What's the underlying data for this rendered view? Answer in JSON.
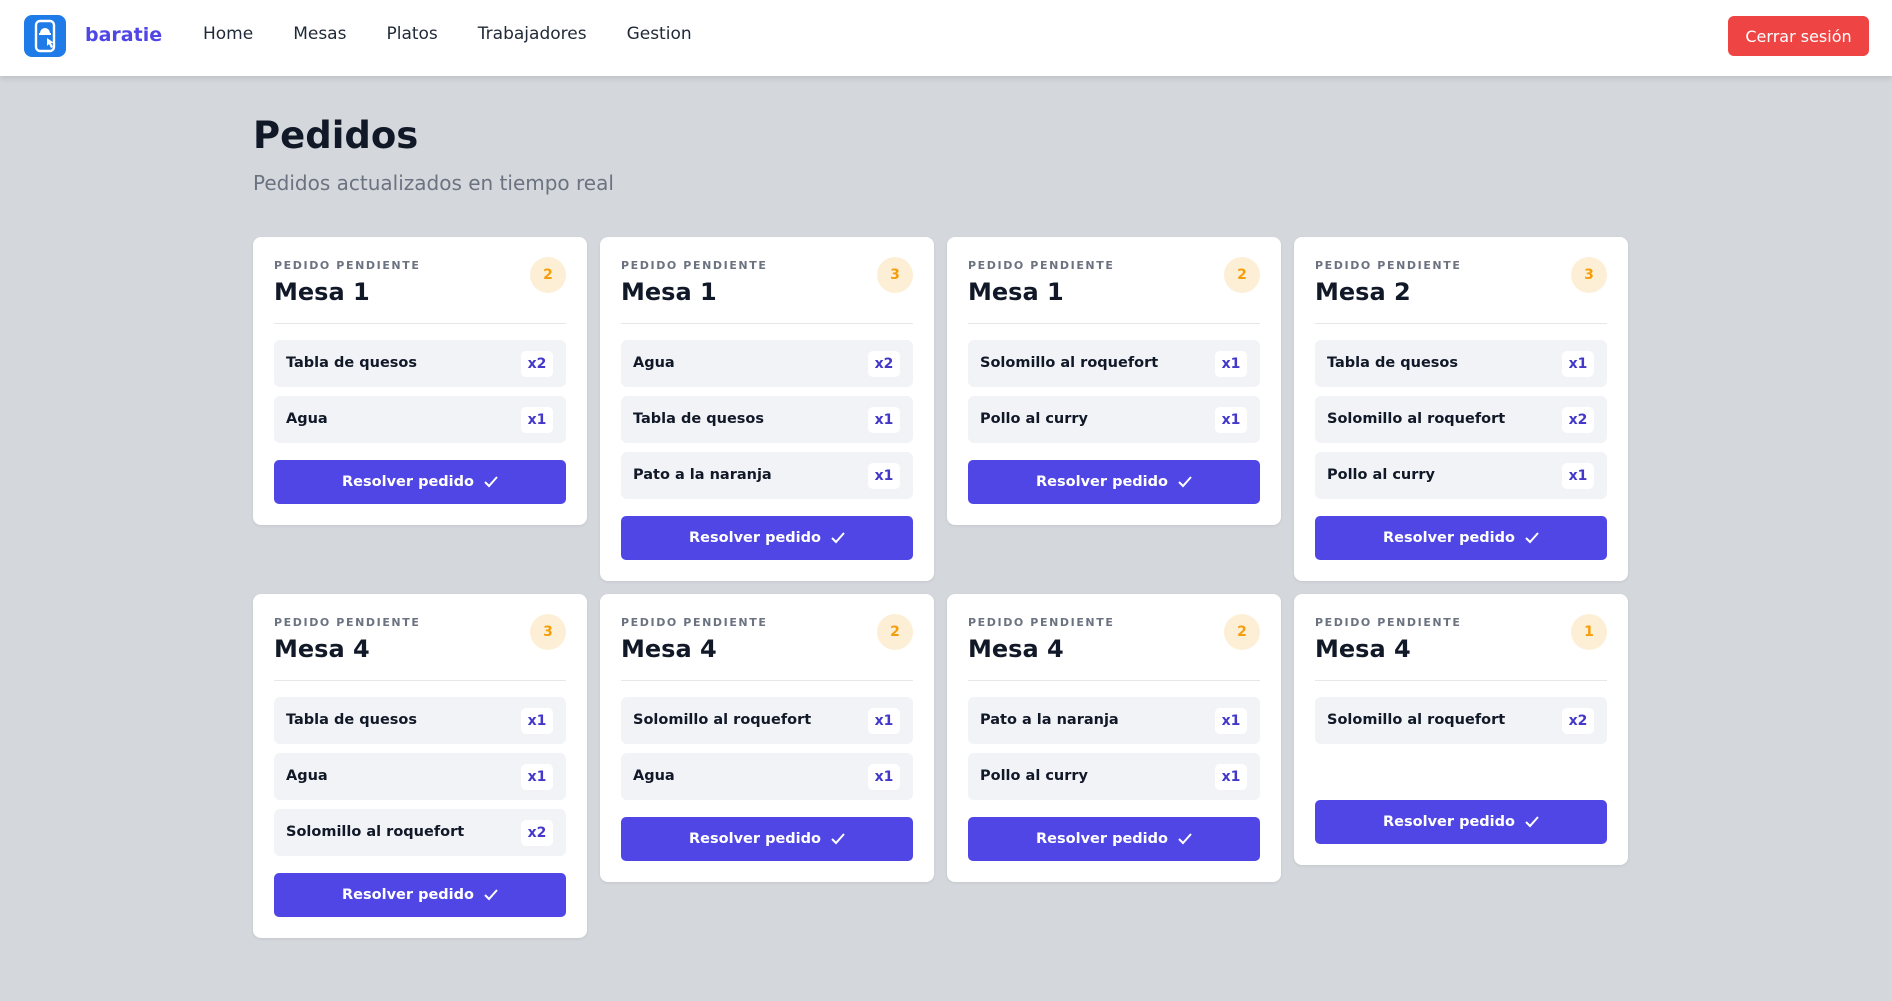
{
  "nav": {
    "brand": "baratie",
    "links": [
      "Home",
      "Mesas",
      "Platos",
      "Trabajadores",
      "Gestion"
    ],
    "logout_label": "Cerrar sesión"
  },
  "page": {
    "title": "Pedidos",
    "subtitle": "Pedidos actualizados en tiempo real"
  },
  "colors": {
    "accent": "#4f46e5",
    "danger": "#ef4444",
    "badge_bg": "#fdefd6",
    "badge_text": "#f59e0b"
  },
  "orders": [
    {
      "status": "PEDIDO PENDIENTE",
      "mesa": "Mesa 1",
      "count": "2",
      "button": "Resolver pedido",
      "items": [
        {
          "name": "Tabla de quesos",
          "qty": "x2"
        },
        {
          "name": "Agua",
          "qty": "x1"
        }
      ]
    },
    {
      "status": "PEDIDO PENDIENTE",
      "mesa": "Mesa 1",
      "count": "3",
      "button": "Resolver pedido",
      "items": [
        {
          "name": "Agua",
          "qty": "x2"
        },
        {
          "name": "Tabla de quesos",
          "qty": "x1"
        },
        {
          "name": "Pato a la naranja",
          "qty": "x1"
        }
      ]
    },
    {
      "status": "PEDIDO PENDIENTE",
      "mesa": "Mesa 1",
      "count": "2",
      "button": "Resolver pedido",
      "items": [
        {
          "name": "Solomillo al roquefort",
          "qty": "x1"
        },
        {
          "name": "Pollo al curry",
          "qty": "x1"
        }
      ]
    },
    {
      "status": "PEDIDO PENDIENTE",
      "mesa": "Mesa 2",
      "count": "3",
      "button": "Resolver pedido",
      "items": [
        {
          "name": "Tabla de quesos",
          "qty": "x1"
        },
        {
          "name": "Solomillo al roquefort",
          "qty": "x2"
        },
        {
          "name": "Pollo al curry",
          "qty": "x1"
        }
      ]
    },
    {
      "status": "PEDIDO PENDIENTE",
      "mesa": "Mesa 4",
      "count": "3",
      "button": "Resolver pedido",
      "items": [
        {
          "name": "Tabla de quesos",
          "qty": "x1"
        },
        {
          "name": "Agua",
          "qty": "x1"
        },
        {
          "name": "Solomillo al roquefort",
          "qty": "x2"
        }
      ]
    },
    {
      "status": "PEDIDO PENDIENTE",
      "mesa": "Mesa 4",
      "count": "2",
      "button": "Resolver pedido",
      "items": [
        {
          "name": "Solomillo al roquefort",
          "qty": "x1"
        },
        {
          "name": "Agua",
          "qty": "x1"
        }
      ]
    },
    {
      "status": "PEDIDO PENDIENTE",
      "mesa": "Mesa 4",
      "count": "2",
      "button": "Resolver pedido",
      "items": [
        {
          "name": "Pato a la naranja",
          "qty": "x1"
        },
        {
          "name": "Pollo al curry",
          "qty": "x1"
        }
      ]
    },
    {
      "status": "PEDIDO PENDIENTE",
      "mesa": "Mesa 4",
      "count": "1",
      "button": "Resolver pedido",
      "items": [
        {
          "name": "Solomillo al roquefort",
          "qty": "x2"
        }
      ]
    }
  ]
}
